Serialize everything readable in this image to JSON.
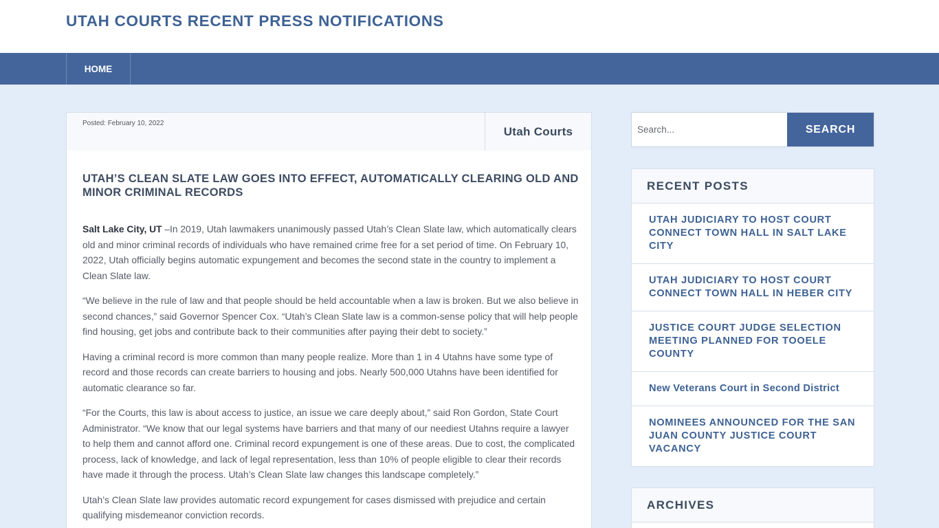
{
  "site": {
    "title": "UTAH COURTS RECENT PRESS NOTIFICATIONS"
  },
  "nav": {
    "items": [
      {
        "label": "HOME"
      }
    ]
  },
  "post": {
    "posted": "Posted: February 10, 2022",
    "author": "Utah Courts",
    "title": "UTAH’S CLEAN SLATE LAW GOES INTO EFFECT, AUTOMATICALLY CLEARING OLD AND MINOR CRIMINAL RECORDS",
    "lead_location": "Salt Lake City, UT",
    "paragraphs": [
      " –In 2019, Utah lawmakers unanimously passed Utah’s Clean Slate law, which automatically clears old and minor criminal records of individuals who have remained crime free for a set period of time. On February 10, 2022, Utah officially begins automatic expungement and becomes the second state in the country to implement a Clean Slate law.",
      "“We believe in the rule of law and that people should be held accountable when a law is broken. But we also believe in second chances,” said Governor Spencer Cox. “Utah’s Clean Slate law is a common-sense policy that will help people find housing, get jobs and contribute back to their communities after paying their debt to society.”",
      "Having a criminal record is more common than many people realize. More than 1 in 4 Utahns have some type of record and those records can create barriers to housing and jobs. Nearly 500,000 Utahns have been identified for automatic clearance so far.",
      "“For the Courts, this law is about access to justice, an issue we care deeply about,” said Ron Gordon, State Court Administrator. “We know that our legal systems have barriers and that many of our neediest Utahns require a lawyer to help them and cannot afford one. Criminal record expungement is one of these areas. Due to cost, the complicated process, lack of knowledge, and lack of legal representation, less than 10% of people eligible to clear their records have made it through the process. Utah’s Clean Slate law changes this landscape completely.”",
      "Utah’s Clean Slate law provides automatic record expungement for cases dismissed with prejudice and certain qualifying misdemeanor conviction records."
    ]
  },
  "sidebar": {
    "search": {
      "placeholder": "Search...",
      "button_label": "SEARCH"
    },
    "recent_posts": {
      "title": "RECENT POSTS",
      "items": [
        {
          "label": "UTAH JUDICIARY TO HOST COURT CONNECT TOWN HALL IN SALT LAKE CITY"
        },
        {
          "label": "UTAH JUDICIARY TO HOST COURT CONNECT TOWN HALL IN HEBER CITY"
        },
        {
          "label": "JUSTICE COURT JUDGE SELECTION MEETING PLANNED FOR TOOELE COUNTY"
        },
        {
          "label": "New Veterans Court in Second District"
        },
        {
          "label": "NOMINEES ANNOUNCED FOR THE SAN JUAN COUNTY JUSTICE COURT VACANCY"
        }
      ]
    },
    "archives": {
      "title": "ARCHIVES"
    }
  },
  "colors": {
    "accent": "#43659b",
    "title_blue": "#3e6294",
    "page_background": "#e3edf9"
  }
}
